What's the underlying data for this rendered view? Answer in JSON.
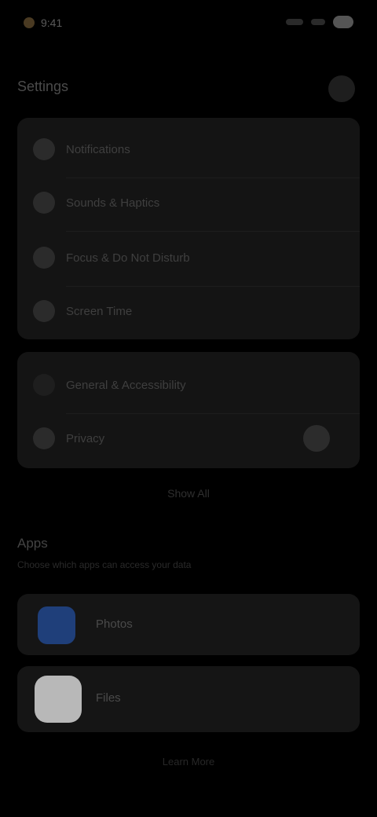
{
  "status": {
    "time": "9:41"
  },
  "header": {
    "title": "Settings"
  },
  "settings_rows": [
    {
      "label": "Notifications"
    },
    {
      "label": "Sounds & Haptics"
    },
    {
      "label": "Focus & Do Not Disturb"
    },
    {
      "label": "Screen Time"
    }
  ],
  "settings_rows_2": [
    {
      "label": "General & Accessibility"
    },
    {
      "label": "Privacy",
      "value": ""
    }
  ],
  "center_link": "Show All",
  "apps_section": {
    "title": "Apps",
    "description": "Choose which apps can access your data"
  },
  "apps": [
    {
      "label": "Photos"
    },
    {
      "label": "Files"
    }
  ],
  "bottom_link": "Learn More",
  "colors": {
    "background": "#000000",
    "card": "#141414",
    "accent_blue": "#1f3f7a"
  }
}
